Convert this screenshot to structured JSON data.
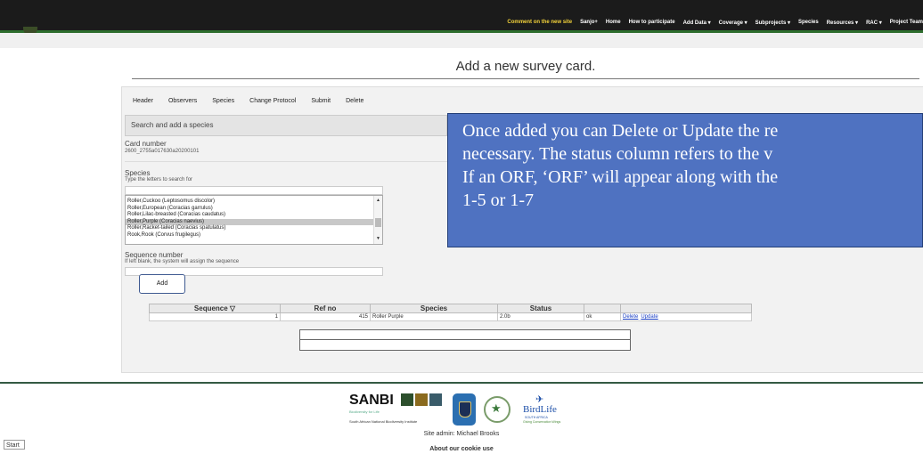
{
  "nav": {
    "comment": "Comment on the new site",
    "items": [
      "Sanjo+",
      "Home",
      "How to participate",
      "Add Data ▾",
      "Coverage ▾",
      "Subprojects ▾",
      "Species",
      "Resources ▾",
      "RAC ▾",
      "Project Team"
    ]
  },
  "page": {
    "title": "Add a new survey card."
  },
  "tabs": [
    "Header",
    "Observers",
    "Species",
    "Change Protocol",
    "Submit",
    "Delete"
  ],
  "search_section": {
    "heading": "Search and add a species"
  },
  "card": {
    "label": "Card number",
    "value": "2600_2755a017630a20200101"
  },
  "species": {
    "label": "Species",
    "hint": "Type the letters to search for",
    "options": [
      "Roller,Cuckoo (Leptosomus discolor)",
      "Roller,European (Coracias garrulus)",
      "Roller,Lilac-breasted (Coracias caudatus)",
      "Roller,Purple (Coracias naevius)",
      "Roller,Racket-tailed (Coracias spatulatus)",
      "Rook,Rook (Corvus frugilegus)"
    ],
    "selected_index": 3
  },
  "sequence": {
    "label": "Sequence number",
    "hint": "If left blank, the system will assign the sequence"
  },
  "add_button": "Add",
  "table": {
    "headers": [
      "Sequence ▽",
      "Ref no",
      "Species",
      "Status",
      "",
      ""
    ],
    "rows": [
      {
        "sequence": "1",
        "ref": "415",
        "species": "Roller Purple",
        "status": "2.0b",
        "ok": "ok",
        "delete": "Delete",
        "update": "Update"
      }
    ]
  },
  "overlay": {
    "lines": [
      "Once added you can Delete or Update the re",
      "necessary. The status column refers to the v",
      "If an ORF, ‘ORF’ will appear along with the",
      "1-5 or 1-7"
    ],
    "color": "#4f72c1"
  },
  "footer": {
    "sanbi_name": "SANBI",
    "sanbi_sub": "Biodiversity for Life",
    "sanbi_full": "South African National Biodiversity Institute",
    "birdlife_name": "BirdLife",
    "birdlife_sub": "SOUTH AFRICA",
    "birdlife_tag": "Giving Conservation Wings",
    "admin": "Site admin: Michael Brooks",
    "cookie": "About our cookie use"
  },
  "taskbar": {
    "start": "Start"
  }
}
